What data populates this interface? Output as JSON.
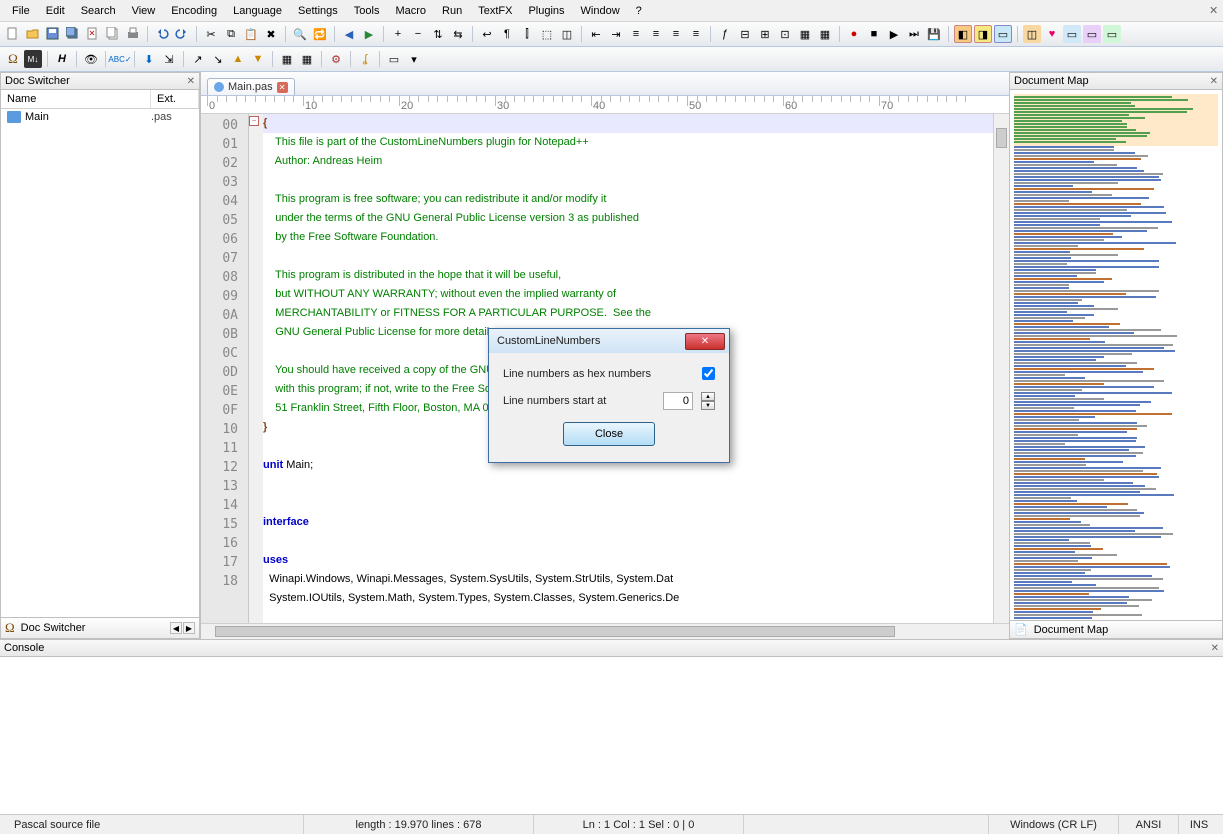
{
  "menu": [
    "File",
    "Edit",
    "Search",
    "View",
    "Encoding",
    "Language",
    "Settings",
    "Tools",
    "Macro",
    "Run",
    "TextFX",
    "Plugins",
    "Window",
    "?"
  ],
  "panels": {
    "docswitcher": {
      "title": "Doc Switcher",
      "cols": [
        "Name",
        "Ext."
      ],
      "rows": [
        {
          "name": "Main",
          "ext": ".pas"
        }
      ],
      "tab": "Doc Switcher"
    },
    "docmap": {
      "title": "Document Map",
      "tab": "Document Map"
    },
    "console": {
      "title": "Console"
    }
  },
  "tabs": [
    {
      "label": "Main.pas"
    }
  ],
  "gutter": [
    "00",
    "01",
    "02",
    "03",
    "04",
    "05",
    "06",
    "07",
    "08",
    "09",
    "0A",
    "0B",
    "0C",
    "0D",
    "0E",
    "0F",
    "10",
    "11",
    "12",
    "13",
    "14",
    "15",
    "16",
    "17",
    "18"
  ],
  "ruler_labels": [
    "0",
    "10",
    "20",
    "30",
    "40",
    "50",
    "60",
    "70"
  ],
  "code": {
    "l00": "{",
    "l01": "    This file is part of the CustomLineNumbers plugin for Notepad++",
    "l02": "    Author: Andreas Heim",
    "l03": "",
    "l04": "    This program is free software; you can redistribute it and/or modify it",
    "l05": "    under the terms of the GNU General Public License version 3 as published",
    "l06": "    by the Free Software Foundation.",
    "l07": "",
    "l08": "    This program is distributed in the hope that it will be useful,",
    "l09": "    but WITHOUT ANY WARRANTY; without even the implied warranty of",
    "l0A": "    MERCHANTABILITY or FITNESS FOR A PARTICULAR PURPOSE.  See the",
    "l0B": "    GNU General Public License for more details.",
    "l0C": "",
    "l0D": "    You should have received a copy of the GNU General Public License along",
    "l0E": "    with this program; if not, write to the Free Software Foundation, Inc.,",
    "l0F": "    51 Franklin Street, Fifth Floor, Boston, MA 02110-1301 USA.",
    "l10": "}",
    "l11": "",
    "l12a": "unit",
    "l12b": " Main;",
    "l13": "",
    "l14": "",
    "l15": "interface",
    "l16": "",
    "l17": "uses",
    "l18": "  Winapi.Windows, Winapi.Messages, System.SysUtils, System.StrUtils, System.Dat",
    "l19": "  System.IOUtils, System.Math, System.Types, System.Classes, System.Generics.De"
  },
  "dialog": {
    "title": "CustomLineNumbers",
    "hex_label": "Line numbers as hex numbers",
    "hex_checked": true,
    "start_label": "Line numbers start at",
    "start_value": "0",
    "close": "Close"
  },
  "status": {
    "lang": "Pascal source file",
    "len": "length : 19.970    lines : 678",
    "pos": "Ln : 1    Col : 1    Sel : 0 | 0",
    "eol": "Windows (CR LF)",
    "enc": "ANSI",
    "ins": "INS"
  }
}
